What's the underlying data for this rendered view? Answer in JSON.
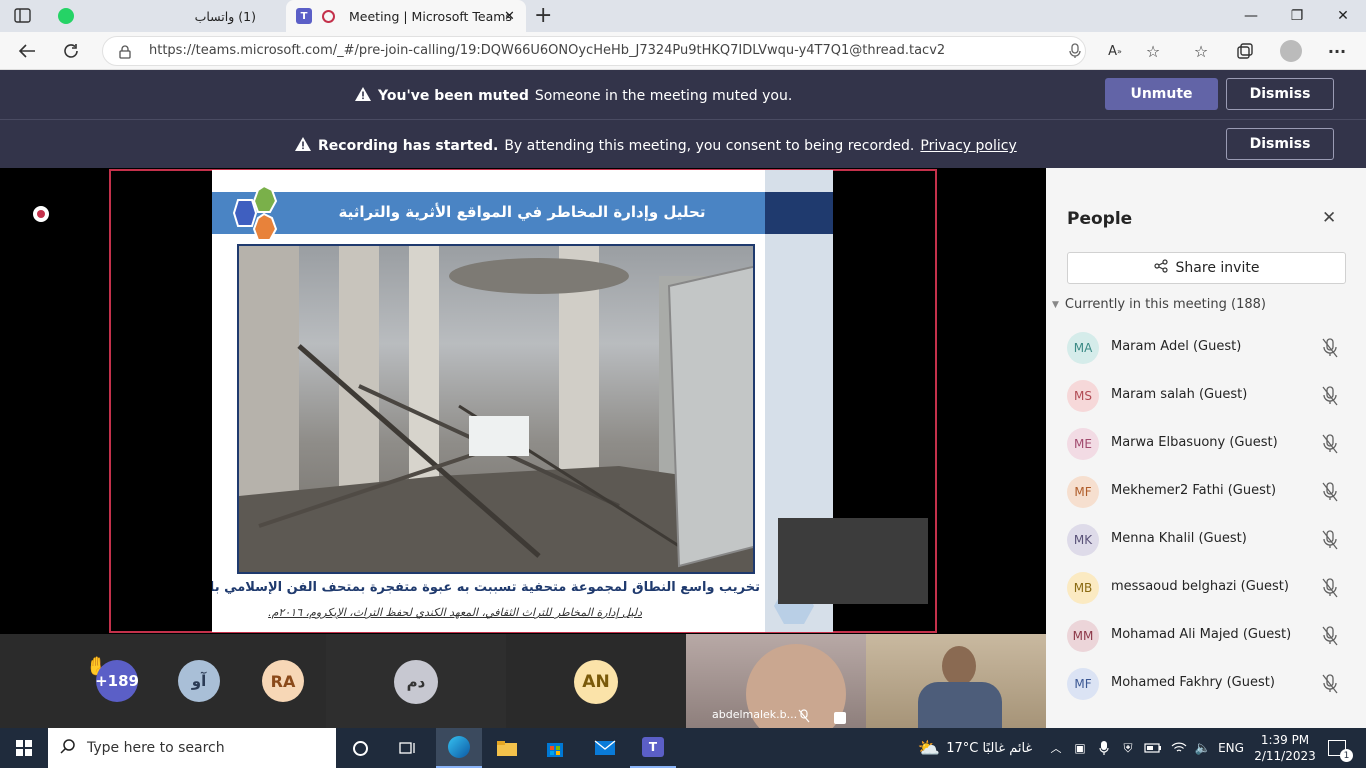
{
  "browser": {
    "tabs": [
      {
        "title": "(1) واتساب"
      },
      {
        "title": "Meeting | Microsoft Teams"
      }
    ],
    "url": "https://teams.microsoft.com/_#/pre-join-calling/19:DQW66U6ONOycHeHb_J7324Pu9tHKQ7IDLVwqu-y4T7Q1@thread.tacv2",
    "new_tab": "+",
    "minimize": "—",
    "restore": "❐",
    "close": "✕",
    "menu": "···"
  },
  "banners": {
    "muted": {
      "title": "You've been muted",
      "text": "Someone in the meeting muted you.",
      "unmute": "Unmute",
      "dismiss": "Dismiss"
    },
    "recording": {
      "title": "Recording has started.",
      "text": "By attending this meeting, you consent to being recorded.",
      "link": "Privacy policy",
      "dismiss": "Dismiss"
    }
  },
  "slide": {
    "title": "تحليل وإدارة المخاطر في المواقع الأثرية والتراثية",
    "caption": "تخريب واسع النطاق لمجموعة متحفية تسببت به عبوة متفجرة بمتحف الفن الإسلامي بالقاهرة .",
    "reference": "دليل إدارة المخاطر للتراث الثقافي، المعهد الكندي لحفظ التراث، الإيكروم، ٢٠١٦م."
  },
  "stage": {
    "tiles": [
      {
        "initials": "+189",
        "color": "#5b5fc7"
      },
      {
        "initials": "آو",
        "color": "#a9bfd7"
      },
      {
        "initials": "RA",
        "color": "#f7d7b6"
      },
      {
        "initials": "دم",
        "color": "#c7c8d1"
      },
      {
        "initials": "AN",
        "color": "#fbe3a9"
      }
    ],
    "video_name": "abdelmalek.b..."
  },
  "people": {
    "title": "People",
    "share_invite": "Share invite",
    "section_label": "Currently in this meeting (188)",
    "list": [
      {
        "initials": "MA",
        "name": "Maram Adel (Guest)",
        "bg": "#d5ecea",
        "fg": "#3b8a85"
      },
      {
        "initials": "MS",
        "name": "Maram salah (Guest)",
        "bg": "#f6d8d9",
        "fg": "#b14b54"
      },
      {
        "initials": "ME",
        "name": "Marwa Elbasuony (Guest)",
        "bg": "#f2dbe4",
        "fg": "#a24b6f"
      },
      {
        "initials": "MF",
        "name": "Mekhemer2 Fathi (Guest)",
        "bg": "#f6dfcf",
        "fg": "#b05d2a"
      },
      {
        "initials": "MK",
        "name": "Menna Khalil (Guest)",
        "bg": "#dedbe9",
        "fg": "#5a5278"
      },
      {
        "initials": "MB",
        "name": "messaoud belghazi (Guest)",
        "bg": "#fbeac2",
        "fg": "#8a6a12"
      },
      {
        "initials": "MM",
        "name": "Mohamad Ali Majed (Guest)",
        "bg": "#ecd5d9",
        "fg": "#8d3a4a"
      },
      {
        "initials": "MF",
        "name": "Mohamed Fakhry (Guest)",
        "bg": "#dbe3f4",
        "fg": "#3b5793"
      }
    ]
  },
  "taskbar": {
    "search_placeholder": "Type here to search",
    "weather": "17°C  غائم غالبًا",
    "language": "ENG",
    "time": "1:39 PM",
    "date": "2/11/2023",
    "notifications": "1"
  }
}
